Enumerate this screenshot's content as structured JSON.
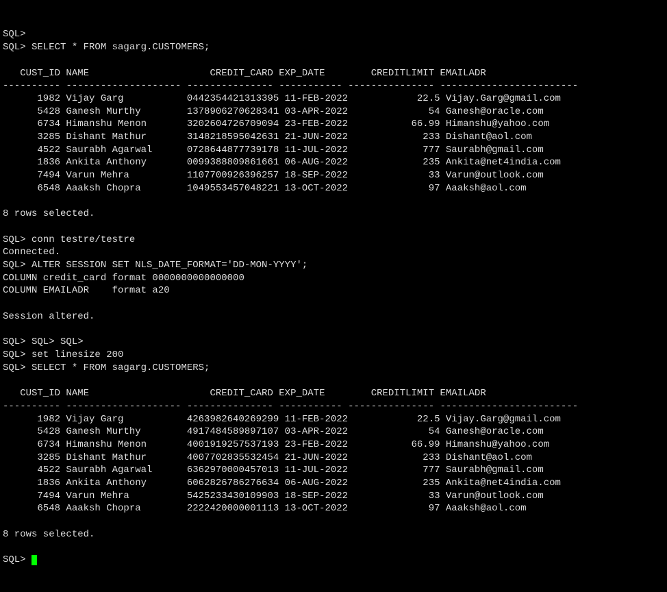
{
  "line0": "SQL>",
  "stmt1": "SQL> SELECT * FROM sagarg.CUSTOMERS;",
  "header": "   CUST_ID NAME                     CREDIT_CARD EXP_DATE        CREDITLIMIT EMAILADR",
  "sep": "---------- -------------------- --------------- ----------- --------------- ------------------------",
  "t1": {
    "r0": "      1982 Vijay Garg           0442354421313395 11-FEB-2022            22.5 Vijay.Garg@gmail.com",
    "r1": "      5428 Ganesh Murthy        1378906270628341 03-APR-2022              54 Ganesh@oracle.com",
    "r2": "      6734 Himanshu Menon       3202604726709094 23-FEB-2022           66.99 Himanshu@yahoo.com",
    "r3": "      3285 Dishant Mathur       3148218595042631 21-JUN-2022             233 Dishant@aol.com",
    "r4": "      4522 Saurabh Agarwal      0728644877739178 11-JUL-2022             777 Saurabh@gmail.com",
    "r5": "      1836 Ankita Anthony       0099388809861661 06-AUG-2022             235 Ankita@net4india.com",
    "r6": "      7494 Varun Mehra          1107700926396257 18-SEP-2022              33 Varun@outlook.com",
    "r7": "      6548 Aaaksh Chopra        1049553457048221 13-OCT-2022              97 Aaaksh@aol.com"
  },
  "rowcount": "8 rows selected.",
  "conn1": "SQL> conn testre/testre",
  "conn2": "Connected.",
  "alter": "SQL> ALTER SESSION SET NLS_DATE_FORMAT='DD-MON-YYYY';",
  "col1": "COLUMN credit_card format 0000000000000000",
  "col2": "COLUMN EMAILADR    format a20",
  "sessalt": "Session altered.",
  "sqlrepeat": "SQL> SQL> SQL>",
  "linesize": "SQL> set linesize 200",
  "stmt2": "SQL> SELECT * FROM sagarg.CUSTOMERS;",
  "t2": {
    "r0": "      1982 Vijay Garg           4263982640269299 11-FEB-2022            22.5 Vijay.Garg@gmail.com",
    "r1": "      5428 Ganesh Murthy        4917484589897107 03-APR-2022              54 Ganesh@oracle.com",
    "r2": "      6734 Himanshu Menon       4001919257537193 23-FEB-2022           66.99 Himanshu@yahoo.com",
    "r3": "      3285 Dishant Mathur       4007702835532454 21-JUN-2022             233 Dishant@aol.com",
    "r4": "      4522 Saurabh Agarwal      6362970000457013 11-JUL-2022             777 Saurabh@gmail.com",
    "r5": "      1836 Ankita Anthony       6062826786276634 06-AUG-2022             235 Ankita@net4india.com",
    "r6": "      7494 Varun Mehra          5425233430109903 18-SEP-2022              33 Varun@outlook.com",
    "r7": "      6548 Aaaksh Chopra        2222420000001113 13-OCT-2022              97 Aaaksh@aol.com"
  },
  "finalprompt": "SQL> "
}
